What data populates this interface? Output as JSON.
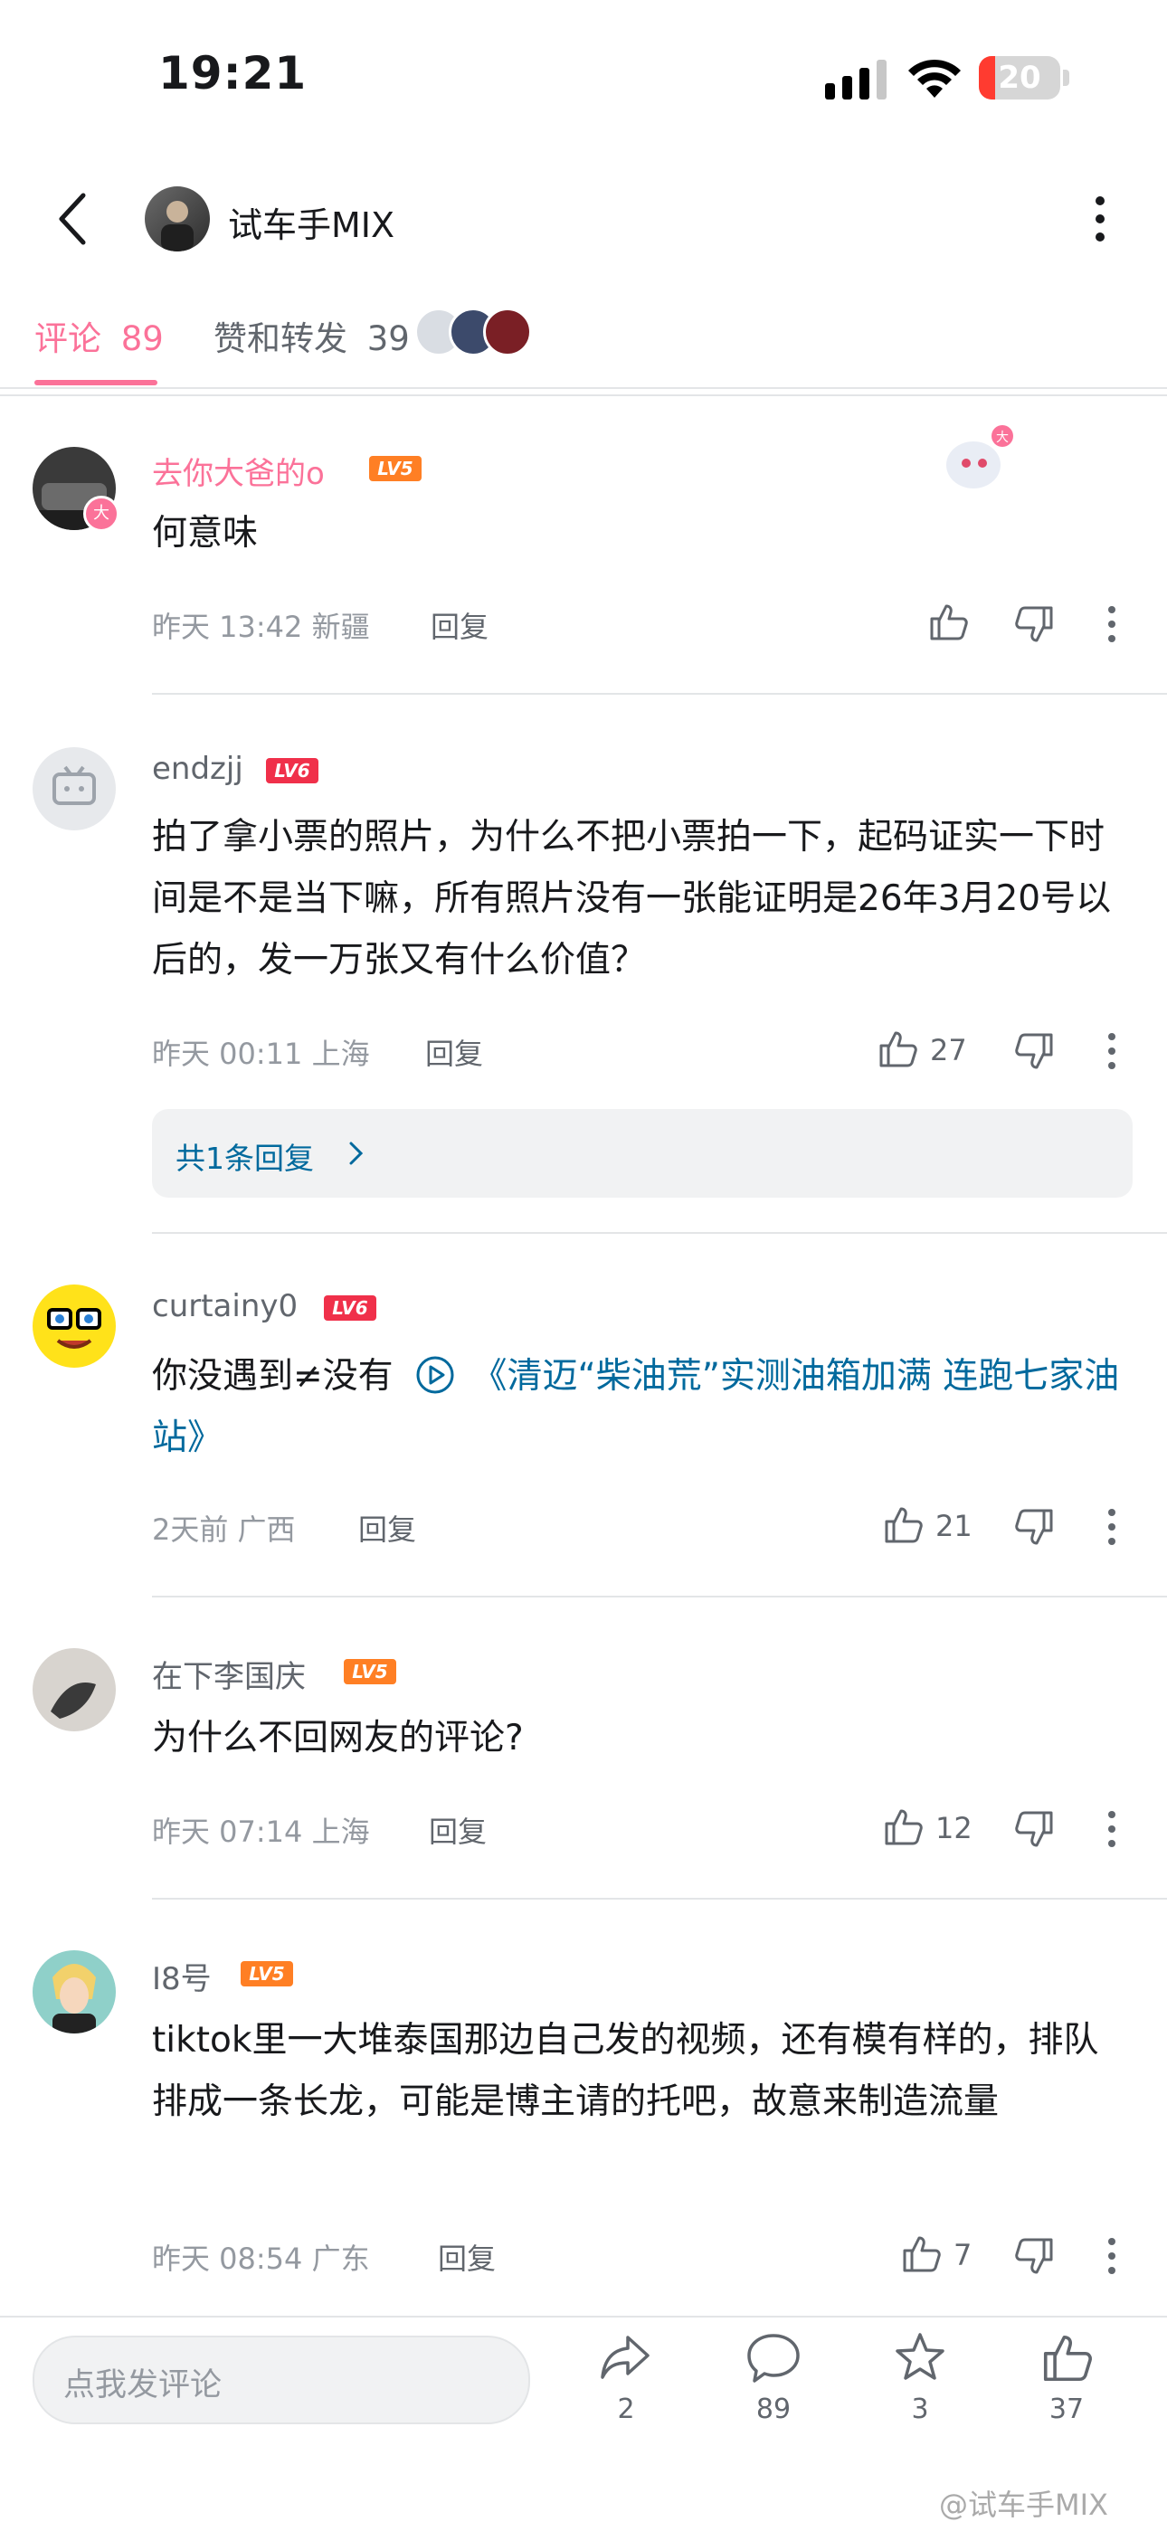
{
  "status_bar": {
    "time": "19:21",
    "battery": "20"
  },
  "header": {
    "title": "试车手MIX"
  },
  "tabs": [
    {
      "label": "评论",
      "count": "89"
    },
    {
      "label": "赞和转发",
      "count": "39"
    }
  ],
  "comments": [
    {
      "name": "去你大爸的o",
      "level": "LV5",
      "text": "何意味",
      "meta": "昨天 13:42 新疆",
      "reply": "回复",
      "likes": ""
    },
    {
      "name": "endzjj",
      "level": "LV6",
      "text": "拍了拿小票的照片，为什么不把小票拍一下，起码证实一下时间是不是当下嘛，所有照片没有一张能证明是26年3月20号以后的，发一万张又有什么价值？",
      "meta": "昨天 00:11 上海",
      "reply": "回复",
      "likes": "27",
      "sub_replies": "共1条回复"
    },
    {
      "name": "curtainy0",
      "level": "LV6",
      "text_prefix": "你没遇到≠没有",
      "link_text": "《清迈“柴油荒”实测油箱加满 连跑七家油站》",
      "meta": "2天前 广西",
      "reply": "回复",
      "likes": "21"
    },
    {
      "name": "在下李国庆",
      "level": "LV5",
      "text": "为什么不回网友的评论?",
      "meta": "昨天 07:14 上海",
      "reply": "回复",
      "likes": "12"
    },
    {
      "name": "I8号",
      "level": "LV5",
      "text": "tiktok里一大堆泰国那边自己发的视频，还有模有样的，排队排成一条长龙，可能是博主请的托吧，故意来制造流量",
      "meta": "昨天 08:54 广东",
      "reply": "回复",
      "likes": "7"
    }
  ],
  "bottom_bar": {
    "input_placeholder": "点我发评论",
    "share_count": "2",
    "comment_count": "89",
    "favorite_count": "3",
    "like_count": "37"
  },
  "watermark": "@试车手MIX",
  "colors": {
    "accent": "#fb7299",
    "link": "#00699d",
    "lv5": "#ff7f24",
    "lv6": "#f0304a",
    "battery_low": "#ff3b30"
  },
  "icons": [
    "back-arrow-icon",
    "more-vertical-icon",
    "thumb-up-icon",
    "thumb-down-icon",
    "share-icon",
    "comment-icon",
    "star-icon",
    "play-icon",
    "chevron-right-icon",
    "signal-icon",
    "wifi-icon",
    "battery-icon"
  ]
}
